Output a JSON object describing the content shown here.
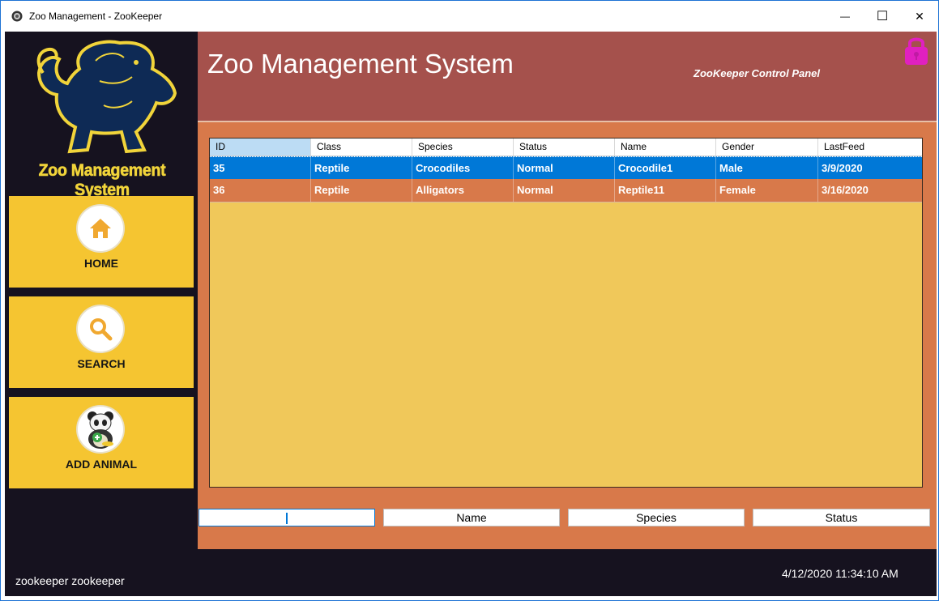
{
  "window": {
    "title": "Zoo Management - ZooKeeper",
    "minimize_glyph": "—",
    "maximize_glyph": "☐",
    "close_glyph": "✕"
  },
  "sidebar": {
    "logo_text": "Zoo Management System",
    "nav": [
      {
        "label": "HOME",
        "icon": "home-icon"
      },
      {
        "label": "SEARCH",
        "icon": "search-icon"
      },
      {
        "label": "ADD ANIMAL",
        "icon": "panda-add-icon"
      }
    ],
    "user": "zookeeper zookeeper"
  },
  "header": {
    "title": "Zoo Management System",
    "subtitle": "ZooKeeper Control Panel",
    "lock_icon": "lock-icon"
  },
  "grid": {
    "columns": [
      "ID",
      "Class",
      "Species",
      "Status",
      "Name",
      "Gender",
      "LastFeed"
    ],
    "rows": [
      {
        "ID": "35",
        "Class": "Reptile",
        "Species": "Crocodiles",
        "Status": "Normal",
        "Name": "Crocodile1",
        "Gender": "Male",
        "LastFeed": "3/9/2020",
        "selected": true
      },
      {
        "ID": "36",
        "Class": "Reptile",
        "Species": "Alligators",
        "Status": "Normal",
        "Name": "Reptile11",
        "Gender": "Female",
        "LastFeed": "3/16/2020",
        "selected": false
      }
    ]
  },
  "filters": {
    "id_value": "",
    "name_value": "Name",
    "species_value": "Species",
    "status_value": "Status"
  },
  "status": {
    "datetime": "4/12/2020 11:34:10 AM"
  },
  "colors": {
    "sidebar": "#16121f",
    "nav_button": "#f5c531",
    "header": "#a5514c",
    "panel": "#d8794a",
    "grid_bg": "#f0c85a",
    "selection": "#0078d7",
    "lock": "#e020c0"
  }
}
